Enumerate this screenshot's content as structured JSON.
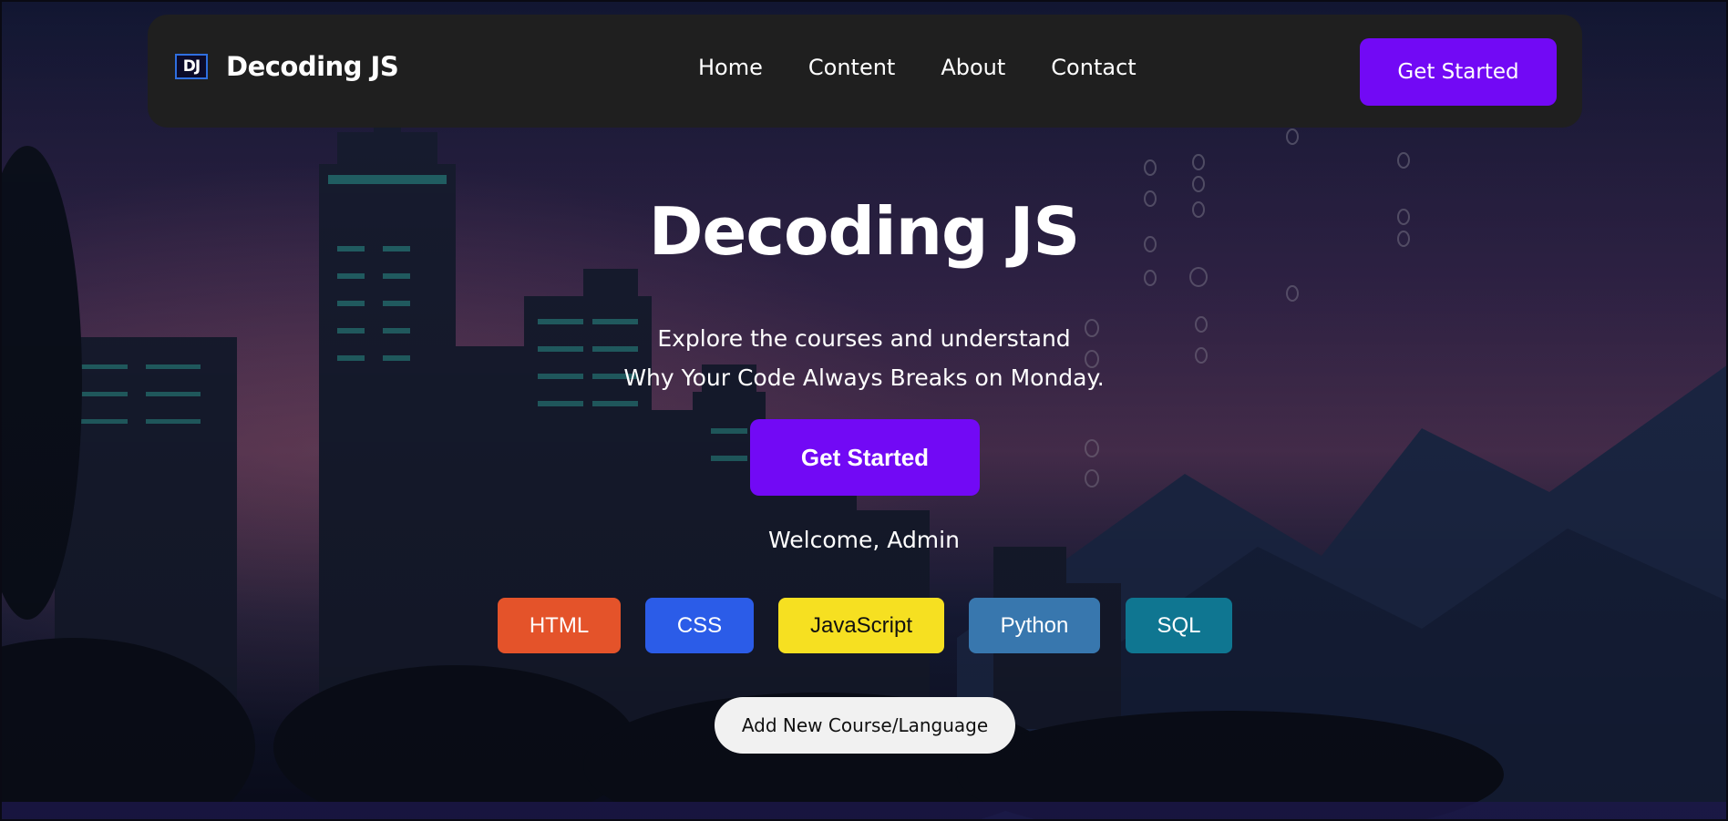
{
  "navbar": {
    "logo_text": "DJ",
    "brand_name": "Decoding JS",
    "links": [
      "Home",
      "Content",
      "About",
      "Contact"
    ],
    "cta_label": "Get Started"
  },
  "hero": {
    "title": "Decoding JS",
    "subtitle_line1": "Explore the courses and understand",
    "subtitle_line2": "Why Your Code Always Breaks on Monday.",
    "cta_label": "Get Started",
    "welcome": "Welcome, Admin"
  },
  "courses": [
    {
      "label": "HTML",
      "color": "#e4532a",
      "text_color": "#ffffff"
    },
    {
      "label": "CSS",
      "color": "#2b5ce8",
      "text_color": "#ffffff"
    },
    {
      "label": "JavaScript",
      "color": "#f6e021",
      "text_color": "#111111"
    },
    {
      "label": "Python",
      "color": "#3877ae",
      "text_color": "#ffffff"
    },
    {
      "label": "SQL",
      "color": "#0f7691",
      "text_color": "#ffffff"
    }
  ],
  "add_course_label": "Add New Course/Language",
  "colors": {
    "accent": "#7209f5",
    "navbar_bg": "#1f1f1f"
  }
}
